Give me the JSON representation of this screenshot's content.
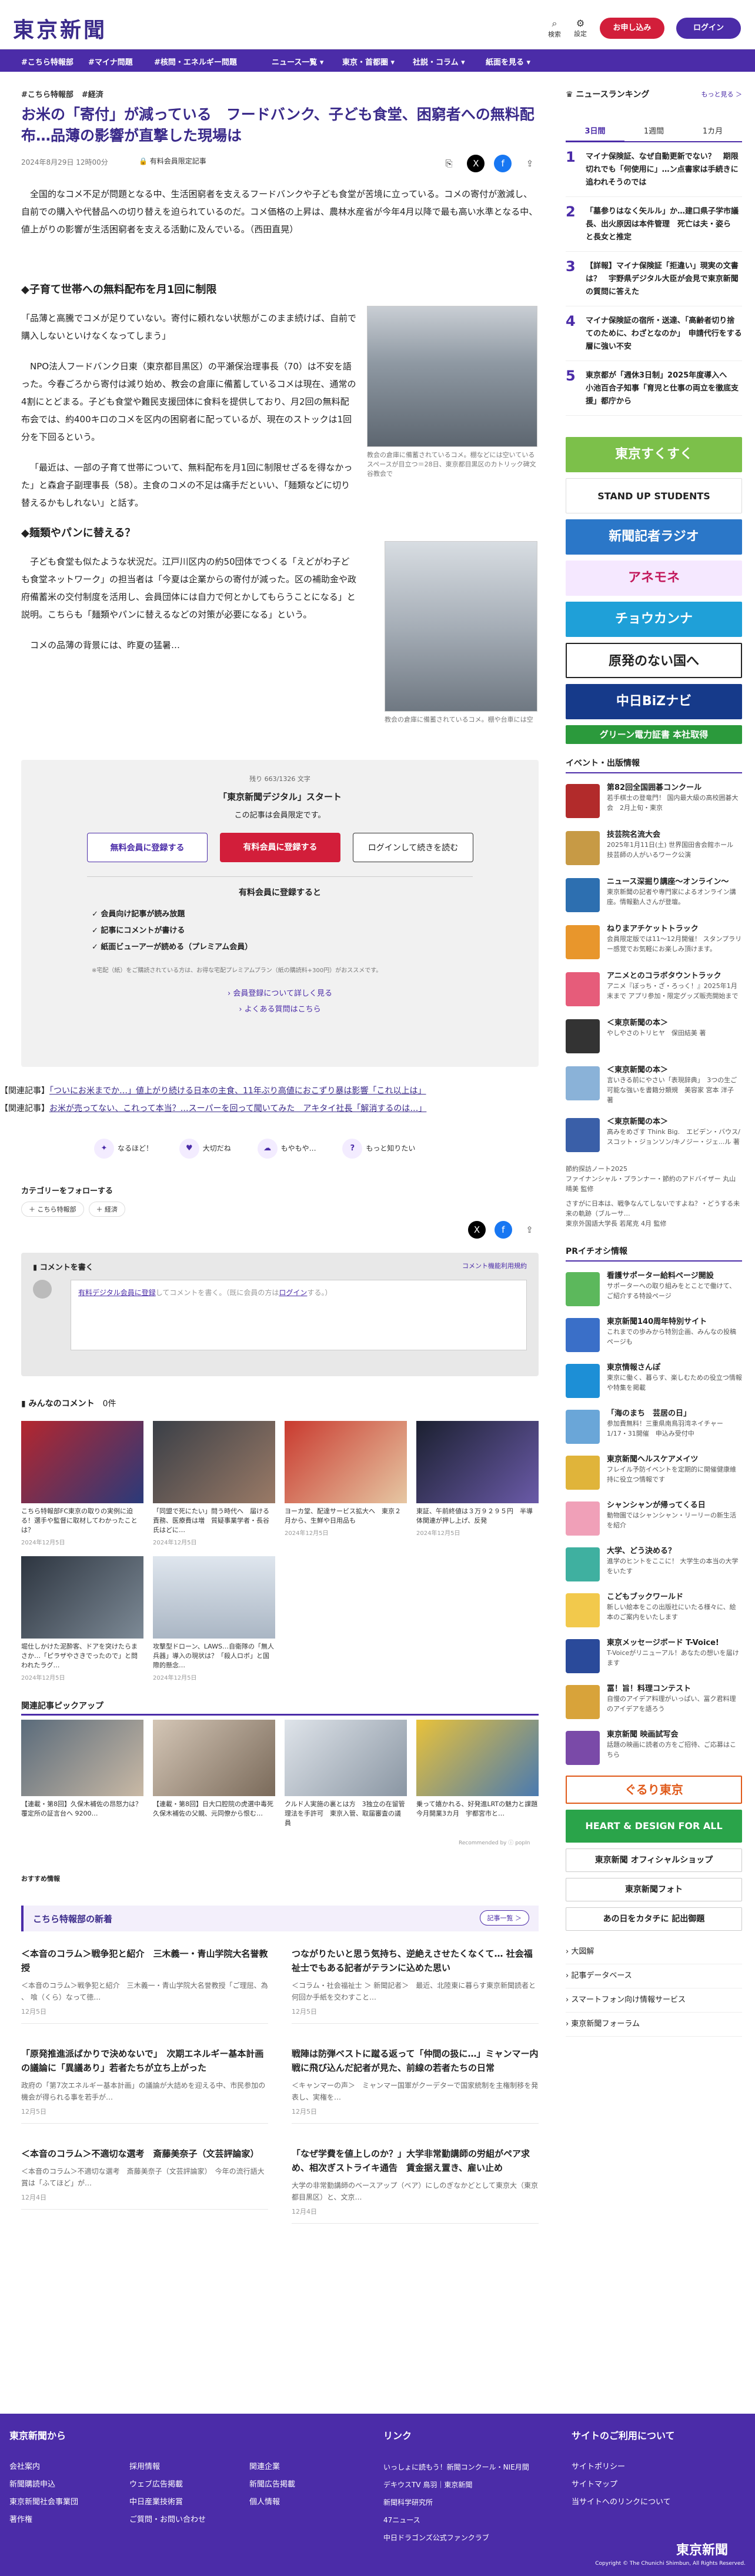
{
  "header": {
    "logo": "東京新聞",
    "search": "検索",
    "settings": "設定",
    "subscribe": "お申し込み",
    "login": "ログイン"
  },
  "nav": [
    "#こちら特報部",
    "#マイナ問題",
    "#核問・エネルギー問題",
    "ニュース一覧 ▾",
    "東京・首都圏 ▾",
    "社説・コラム ▾",
    "紙面を見る ▾"
  ],
  "article": {
    "tags": [
      "#こちら特報部",
      "#経済"
    ],
    "title": "お米の「寄付」が減っている　フードバンク、子ども食堂、困窮者への無料配布…品薄の影響が直撃した現場は",
    "date": "2024年8月29日 12時00分",
    "badge": "有料会員限定記事",
    "comments": "0",
    "lead": "全国的なコメ不足が問題となる中、生活困窮者を支えるフードバンクや子ども食堂が苦境に立っている。コメの寄付が激減し、自前での購入や代替品への切り替えを迫られているのだ。コメ価格の上昇は、農林水産省が今年4月以降で最も高い水準となる中、値上がりの影響が生活困窮者を支える活動に及んでいる。（西田直晃）",
    "h1": "◆子育て世帯への無料配布を月1回に制限",
    "p1": "「品薄と高騰でコメが足りていない。寄付に頼れない状態がこのまま続けば、自前で購入しないといけなくなってしまう」",
    "p2": "NPO法人フードバンク日東（東京都目黒区）の平瀬保治理事長（70）は不安を語った。今春ごろから寄付は減り始め、教会の倉庫に備蓄しているコメは現在、通常の4割にとどまる。子ども食堂や難民支援団体に食料を提供しており、月2回の無料配布会では、約400キロのコメを区内の困窮者に配っているが、現在のストックは1回分を下回るという。",
    "p3": "「最近は、一部の子育て世帯について、無料配布を月1回に制限せざるを得なかった」と森倉子副理事長（58）。主食のコメの不足は痛手だといい、「麺類などに切り替えるかもしれない」と話す。",
    "fig1_cap": "教会の倉庫に備蓄されているコメ。棚などには空いているスペースが目立つ＝28日、東京都目黒区のカトリック碑文谷教会で",
    "h2": "◆麺類やパンに替える？",
    "p4": "子ども食堂も似たような状況だ。江戸川区内の約50団体でつくる「えどがわ子ども食堂ネットワーク」の担当者は「今夏は企業からの寄付が減った。区の補助金や政府備蓄米の交付制度を活用し、会員団体には自力で何とかしてもらうことになる」と説明。こちらも「麺類やパンに替えるなどの対策が必要になる」という。",
    "fig2_cap": "教会の倉庫に備蓄されているコメ。棚や台車には空",
    "p5": "コメの品薄の背景には、昨夏の猛暑…"
  },
  "paywall": {
    "count": "残り 663/1326 文字",
    "title": "「東京新聞デジタル」スタート",
    "sub": "この記事は会員限定です。",
    "free": "無料会員に登録する",
    "paid": "有料会員に登録する",
    "login": "ログインして続きを読む",
    "benefits_title": "有料会員に登録すると",
    "benefits": [
      "会員向け記事が読み放題",
      "記事にコメントが書ける",
      "紙面ビューアーが読める（プレミアム会員）"
    ],
    "note": "※宅配（紙）をご購読されている方は、お得な宅配プレミアムプラン（紙の購読料+300円）がおススメです。",
    "link1": "会員登録について詳しく見る",
    "link2": "よくある質問はこちら"
  },
  "related": [
    {
      "label": "【関連記事】",
      "text": "「ついにお米までか…」値上がり続ける日本の主食、11年ぶり高値におこずり暴は影響「これ以上は」"
    },
    {
      "label": "【関連記事】",
      "text": "お米が売ってない、これって本当？…スーパーを回って聞いてみた　アキタイ社長「解消するのは…」"
    }
  ],
  "reactions": [
    "なるほど！",
    "大切だね",
    "もやもや…",
    "もっと知りたい"
  ],
  "follow": {
    "title": "カテゴリーをフォローする",
    "tags": [
      "＋ こちら特報部",
      "＋ 経済"
    ]
  },
  "comment": {
    "title": "コメントを書く",
    "guide": "コメント機能利用規約",
    "placeholder_a": "有料デジタル会員に登録",
    "placeholder_b": "してコメントを書く。（既に会員の方は",
    "placeholder_c": "ログイン",
    "placeholder_d": "する。）"
  },
  "everyone": {
    "title": "みんなのコメント",
    "count": "0件"
  },
  "tiles": [
    {
      "t": "こちら特報部FC東京の取りの実例に迫る！選手や監督に取材してわかったことは？",
      "d": "2024年12月5日"
    },
    {
      "t": "「同盟で死にたい」問う時代へ　届ける責務、医療費は増　質疑事業学者・長谷氏はどに…",
      "d": "2024年12月5日"
    },
    {
      "t": "ヨーカ堂、配達サービス拡大へ　東京２月から、生鮮や日用品も",
      "d": "2024年12月5日"
    },
    {
      "t": "東証、午前終値は３万９２９５円　半導体関連が押し上げ、反発",
      "d": "2024年12月5日"
    },
    {
      "t": "堀仕しかけた泥酔客、ドアを突けたらまさか…「ピラザやさきでったので」と問われたラグ…",
      "d": "2024年12月5日"
    },
    {
      "t": "攻撃型ドローン、LAWS…自衛隊の「無人兵器」導入の現状は？「殺人ロボ」と国際的懸念…",
      "d": "2024年12月5日"
    }
  ],
  "pickup": {
    "title": "関連記事ピックアップ",
    "items": [
      {
        "t": "【連載・第8回】久保木補佐の昂怒力は？覆定所の証言台へ 9200…",
        "d": ""
      },
      {
        "t": "【連載・第8回】日大口腔院の虎選中毒死　久保木補佐の父親、元同僚から恨む…",
        "d": ""
      },
      {
        "t": "クルド人実施の裏とは方　3独立の在留管理法を手許可　東京入管、取届審査の議員",
        "d": ""
      },
      {
        "t": "乗って嬉かれる、好発進LRTの魅力と課題　今月開業3カ月　宇都宮市と…",
        "d": ""
      }
    ],
    "credit": "Recommended by ⓘ popIn"
  },
  "recommend_label": "おすすめ情報",
  "kochira": {
    "title": "こちら特報部の新着",
    "more": "記事一覧 ＞",
    "items": [
      {
        "t": "＜本音のコラム＞戦争犯と紹介　三木義一・青山学院大名誉教授",
        "s": "＜本音のコラム＞戦争犯と紹介　三木義一・青山学院大名誉教授「ご理屈、為 、 喰（くら）なって徳…",
        "d": "12月5日"
      },
      {
        "t": "つながりたいと思う気持ち、逆絶えさせたくなくて… 社会福祉士でもある記者がテランに込めた思い",
        "s": "＜コラム・社会福祉士 ＞ 新聞記者＞　最近、北陸東に暮らす東京新聞読者と何回か手紙を交わすこと…",
        "d": "12月5日"
      },
      {
        "t": "「原発推進派ばかりで決めないで」　次期エネルギー基本計画の議論に「異議あり」若者たちが立ち上がった",
        "s": "政府の「第7次エネルギー基本計画」の議論が大詰めを迎える中、市民参加の機会が得られる事を若手が…",
        "d": "12月5日"
      },
      {
        "t": "戦陣は防弾ベストに蹴る返って「仲間の扱に…」ミャンマー内戦に飛び込んだ記者が見た、前線の若者たちの日常",
        "s": "＜キャンマーの声＞　ミャンマー国軍がクーデターで国家統制を主権制移を発表し、実権を…",
        "d": "12月5日"
      },
      {
        "t": "＜本音のコラム＞不適切な選考　斎藤美奈子（文芸評論家）",
        "s": "＜本音のコラム＞不適切な選考　斎藤美奈子（文芸評論家）　今年の流行語大賞は「ふてほど」が…",
        "d": "12月4日"
      },
      {
        "t": "「なぜ学費を値上しのか？」大学非常勤講師の労組がペア求め、相次ぎストライキ通告　賃金据え置き、雇い止め",
        "s": "大学の非常勤講師のベースアップ（ベア）にしのぎなかどとして東京大（東京都目黒区）と、文京…",
        "d": "12月4日"
      }
    ]
  },
  "sidebar": {
    "ranking_title": "ニュースランキング",
    "ranking_more": "もっと見る ＞",
    "tabs": [
      "3日間",
      "1週間",
      "1カ月"
    ],
    "ranking": [
      "マイナ保険証、なぜ自動更新でない？　期限切れでも「何使用に」…ン点書家は手続きに追われそうのでは",
      "「墓参りはなく矢ルル」か…建口県子学市議長、出火原因は本件管理　死亡は夫・姿ら　と長女と推定",
      "【詳報】マイナ保険証「拒違い」現実の文書は？　宇野県デジタル大臣が会見で東京新聞の質問に答えた",
      "マイナ保険証の宿所・送達、「高齢者切り捨てのために、わざとなのか」　申請代行をする層に強い不安",
      "東京都が「週休3日制」2025年度導入へ　小池百合子知事「育児と仕事の両立を徹底支援」都庁から"
    ],
    "banners": [
      "東京すくすく",
      "STAND UP STUDENTS",
      "新聞記者ラジオ",
      "アネモネ",
      "チョウカンナ",
      "原発のない国へ",
      "中日BiZナビ",
      "グリーン電力証書 本社取得"
    ],
    "events_title": "イベント・出版情報",
    "events": [
      {
        "t": "第82回全国囲碁コンクール",
        "s": "若手棋士の登竜門！ 国内最大級の高校囲碁大会　2月上旬・東京"
      },
      {
        "t": "技芸院名流大会",
        "s": "2025年1月11日(土) 世界国田舎会館ホール　技芸師の人がいるワーク公演"
      },
      {
        "t": "ニュース深掘り講座〜オンライン〜",
        "s": "東京新聞の記者や専門家によるオンライン講座。情報勤人さんが登壇。"
      },
      {
        "t": "ねりまアチケットトラック",
        "s": "会員限定版では11〜12月開催！ スタンプラリー感覚でお気軽にお楽しみ頂けます。"
      },
      {
        "t": "アニメとのコラボタウントラック",
        "s": "アニメ『ぼっち・ざ・ろっく！』2025年1月末まで アプリ参加・限定グッズ販売開始まで"
      },
      {
        "t": "＜東京新聞の本＞",
        "s": "やしやさのトリヒヤ　保田結美 著"
      },
      {
        "t": "＜東京新聞の本＞",
        "s": "言いきる前にやさい「表現辞典」　3つの生ご可能な強いを書籍分類規　美容家 宮本 洋子 著"
      },
      {
        "t": "＜東京新聞の本＞",
        "s": "高みをめざす Think Big.　エビデン・バウス/スコット・ジョンソン/キノジー・ジェ...ル 著"
      }
    ],
    "more_links": [
      "節約探訪ノート2025",
      "ファイナンシャル・プランナー・節約のアドバイザー 丸山晴美 監修",
      "さすがに日本は、戦争なんてしないですよね？・どうする未来の軌跡（ブルーサ…",
      "東京外国語大学長 若尾克 4月 監修"
    ],
    "pr_title": "PRイチオシ情報",
    "pr": [
      {
        "t": "看護サポーター給料ページ開設",
        "s": "サポーターへの取り組みをとことで働けて、ご紹介する特設ページ"
      },
      {
        "t": "東京新聞140周年特別サイト",
        "s": "これまでの歩みから特別企画、みんなの投稿ページも"
      },
      {
        "t": "東京情報さんぽ",
        "s": "東京に働く、暮らす、楽しむための役立つ情報や特集を掲載"
      },
      {
        "t": "「海のまち　芸居の日」",
        "s": "参加費無料！三重県南鳥羽湾ネイチャー1/17・31開催　申込み受付中"
      },
      {
        "t": "東京新聞ヘルスケアメイツ",
        "s": "フレイル予防イベントを定期的に開催健康維持に役立つ情報です"
      },
      {
        "t": "シャンシャンが帰ってくる日",
        "s": "動物園ではシャンシャン・リーリーの新生活を紹介"
      },
      {
        "t": "大学、どう決める？",
        "s": "進学のヒントをここに！ 大学生の本当の大学をいたす"
      },
      {
        "t": "こどもブックワールド",
        "s": "新しい絵本をこの出版社にいたる様々に、絵本のご案内をいたします"
      },
      {
        "t": "東京メッセージボード T-Voice!",
        "s": "T-Voiceがリニューアル！あなたの想いを届けます"
      },
      {
        "t": "冨！旨！料理コンテスト",
        "s": "自慢のアイデア料理がいっぱい、冨ク君料理のアイデアを語ろう"
      },
      {
        "t": "東京新聞 映画試写会",
        "s": "話題の映画に読者の方をご招待、ご応募はこちら"
      }
    ],
    "pr_banners": [
      "ぐるり東京",
      "HEART & DESIGN FOR ALL",
      "東京新聞 オフィシャルショップ",
      "東京新聞フォト",
      "あの日をカタチに 記出御題"
    ],
    "bottom_links": [
      "大図解",
      "記事データベース",
      "スマートフォン向け情報サービス",
      "東京新聞フォーラム"
    ]
  },
  "footer": {
    "h1": "東京新聞から",
    "h2": "リンク",
    "h3": "サイトのご利用について",
    "col1": [
      "会社案内",
      "新聞購読申込",
      "東京新聞社会事業団",
      "著作権"
    ],
    "col2": [
      "採用情報",
      "ウェブ広告掲載",
      "中日産業技術賞",
      "ご質問・お問い合わせ"
    ],
    "col3": [
      "関連企業",
      "新聞広告掲載",
      "個人情報"
    ],
    "col4": [
      "いっしょに読もう！新聞コンクール・NIE月間",
      "デキウスTV 鳥羽｜東京新聞",
      "新聞科学研究所",
      "47ニュース",
      "中日ドラゴンズ公式ファンクラブ"
    ],
    "col5": [
      "サイトポリシー",
      "サイトマップ",
      "当サイトへのリンクについて"
    ],
    "logo": "東京新聞",
    "copy": "Copyright © The Chunichi Shimbun, All Rights Reserved."
  }
}
